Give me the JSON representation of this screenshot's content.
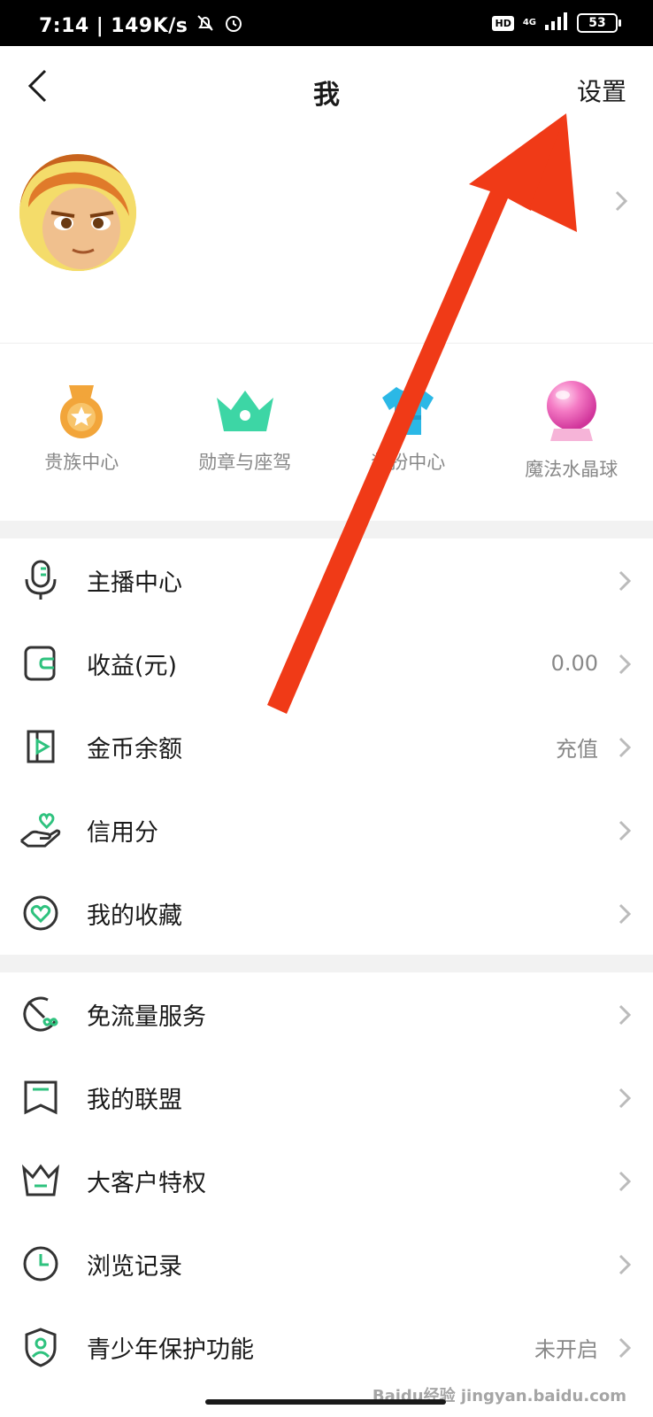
{
  "status_bar": {
    "time": "7:14",
    "speed": "149K/s",
    "network": "4G",
    "hd": "HD",
    "battery": "53"
  },
  "nav": {
    "title": "我",
    "settings_label": "设置"
  },
  "quick_links": [
    {
      "label": "贵族中心",
      "icon": "noble-medal-icon",
      "color": "#f2a53a"
    },
    {
      "label": "勋章与座驾",
      "icon": "crown-icon",
      "color": "#3dd6a5"
    },
    {
      "label": "装扮中心",
      "icon": "tshirt-icon",
      "color": "#2bb8e6"
    },
    {
      "label": "魔法水晶球",
      "icon": "crystal-ball-icon",
      "color": "#f05ab0"
    }
  ],
  "menu_group_1": [
    {
      "label": "主播中心",
      "value": "",
      "icon": "microphone-icon"
    },
    {
      "label": "收益(元)",
      "value": "0.00",
      "icon": "wallet-icon"
    },
    {
      "label": "金币余额",
      "value": "充值",
      "icon": "coin-play-icon"
    },
    {
      "label": "信用分",
      "value": "",
      "icon": "hand-heart-icon"
    },
    {
      "label": "我的收藏",
      "value": "",
      "icon": "heart-circle-icon"
    }
  ],
  "menu_group_2": [
    {
      "label": "免流量服务",
      "value": "",
      "icon": "data-free-icon"
    },
    {
      "label": "我的联盟",
      "value": "",
      "icon": "banner-icon"
    },
    {
      "label": "大客户特权",
      "value": "",
      "icon": "vip-crown-icon"
    },
    {
      "label": "浏览记录",
      "value": "",
      "icon": "clock-icon"
    },
    {
      "label": "青少年保护功能",
      "value": "未开启",
      "icon": "shield-user-icon"
    }
  ],
  "colors": {
    "accent_green": "#2ec27e",
    "arrow_red": "#f03a17"
  },
  "watermark": "Baidu经验 jingyan.baidu.com"
}
